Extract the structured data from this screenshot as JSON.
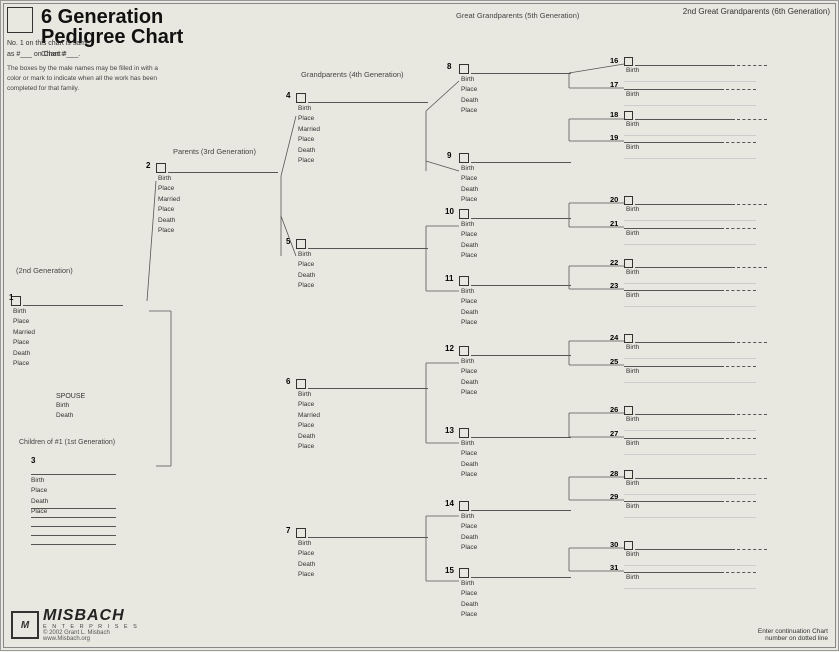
{
  "header": {
    "title": "6 Generation Pedigree Chart",
    "chart_label": "Chart #",
    "no1_text": "No. 1 on this chart is same",
    "as_text": "as #___ on Chart #___.",
    "boxes_text": "The boxes by the male names may be filled in with a color or mark to indicate when all the work has been completed for that family.",
    "gen2_label": "(2nd Generation)",
    "parents_label": "Parents (3rd Generation)",
    "grandparents_label": "Grandparents (4th Generation)",
    "great_label": "Great Grandparents (5th Generation)",
    "great2_label": "2nd Great Grandparents (6th Generation)"
  },
  "fields": {
    "birth": "Birth",
    "place": "Place",
    "married": "Married",
    "death": "Death",
    "spouse": "SPOUSE",
    "children": "Children of #1 (1st Generation)"
  },
  "persons": {
    "p1": {
      "id": "1",
      "fields": [
        "Birth",
        "Place",
        "Married",
        "Place",
        "Death",
        "Place"
      ]
    },
    "p2": {
      "id": "2",
      "fields": [
        "Birth",
        "Place",
        "Married",
        "Place",
        "Death",
        "Place"
      ]
    },
    "p3": {
      "id": "3",
      "fields": [
        "Birth",
        "Place",
        "Death",
        "Place"
      ]
    },
    "p4": {
      "id": "4",
      "fields": [
        "Birth",
        "Place",
        "Married",
        "Place",
        "Death",
        "Place"
      ]
    },
    "p5": {
      "id": "5",
      "fields": [
        "Birth",
        "Place",
        "Death",
        "Place"
      ]
    },
    "p6": {
      "id": "6",
      "fields": [
        "Birth",
        "Place",
        "Married",
        "Place",
        "Death",
        "Place"
      ]
    },
    "p7": {
      "id": "7",
      "fields": [
        "Birth",
        "Place",
        "Death",
        "Place"
      ]
    },
    "p8": {
      "id": "8",
      "fields": [
        "Birth",
        "Place",
        "Death",
        "Place"
      ]
    },
    "p9": {
      "id": "9",
      "fields": [
        "Birth",
        "Place",
        "Death",
        "Place"
      ]
    },
    "p10": {
      "id": "10",
      "fields": [
        "Birth",
        "Place",
        "Death",
        "Place"
      ]
    },
    "p11": {
      "id": "11",
      "fields": [
        "Birth",
        "Place",
        "Death",
        "Place"
      ]
    },
    "p12": {
      "id": "12",
      "fields": [
        "Birth",
        "Place",
        "Death",
        "Place"
      ]
    },
    "p13": {
      "id": "13",
      "fields": [
        "Birth",
        "Place",
        "Death",
        "Place"
      ]
    },
    "p14": {
      "id": "14",
      "fields": [
        "Birth",
        "Place",
        "Death",
        "Place"
      ]
    },
    "p15": {
      "id": "15",
      "fields": [
        "Birth",
        "Place",
        "Death",
        "Place"
      ]
    },
    "p16": {
      "id": "16",
      "fields": [
        "Birth"
      ]
    },
    "p17": {
      "id": "17",
      "fields": [
        "Birth"
      ]
    },
    "p18": {
      "id": "18",
      "fields": [
        "Birth"
      ]
    },
    "p19": {
      "id": "19",
      "fields": [
        "Birth"
      ]
    },
    "p20": {
      "id": "20",
      "fields": [
        "Birth"
      ]
    },
    "p21": {
      "id": "21",
      "fields": [
        "Birth"
      ]
    },
    "p22": {
      "id": "22",
      "fields": [
        "Birth"
      ]
    },
    "p23": {
      "id": "23",
      "fields": [
        "Birth"
      ]
    },
    "p24": {
      "id": "24",
      "fields": [
        "Birth"
      ]
    },
    "p25": {
      "id": "25",
      "fields": [
        "Birth"
      ]
    },
    "p26": {
      "id": "26",
      "fields": [
        "Birth"
      ]
    },
    "p27": {
      "id": "27",
      "fields": [
        "Birth"
      ]
    },
    "p28": {
      "id": "28",
      "fields": [
        "Birth"
      ]
    },
    "p29": {
      "id": "29",
      "fields": [
        "Birth"
      ]
    },
    "p30": {
      "id": "30",
      "fields": [
        "Birth"
      ]
    },
    "p31": {
      "id": "31",
      "fields": [
        "Birth"
      ]
    }
  },
  "footer": {
    "logo": "MISBACH",
    "enterprises": "E N T E R P R I S E S",
    "copyright": "© 2002 Grant L. Misbach",
    "website": "www.Misbach.org",
    "continue_label": "Enter continuation Chart",
    "continue_label2": "number on dotted line"
  }
}
